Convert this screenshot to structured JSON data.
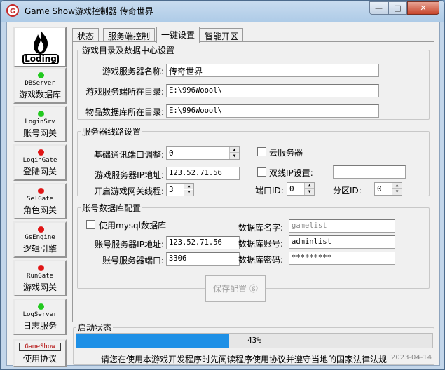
{
  "window": {
    "title": "Game Show游戏控制器  传奇世界"
  },
  "title_controls": {
    "minimize": "—",
    "maximize": "□",
    "close": "✕"
  },
  "nav": {
    "logo_label": "Loding",
    "items": [
      {
        "en": "DBServer",
        "cn": "游戏数据库",
        "status_color": "#22c91f"
      },
      {
        "en": "LoginSrv",
        "cn": "账号网关",
        "status_color": "#22c91f"
      },
      {
        "en": "LoginGate",
        "cn": "登陆网关",
        "status_color": "#e01515"
      },
      {
        "en": "SelGate",
        "cn": "角色网关",
        "status_color": "#e01515"
      },
      {
        "en": "GsEngine",
        "cn": "逻辑引擎",
        "status_color": "#e01515"
      },
      {
        "en": "RunGate",
        "cn": "游戏网关",
        "status_color": "#e01515"
      },
      {
        "en": "LogServer",
        "cn": "日志服务",
        "status_color": "#22c91f"
      }
    ],
    "about": {
      "en": "GameShow",
      "cn": "使用协议"
    }
  },
  "tabs": [
    "状态",
    "服务端控制",
    "一键设置",
    "智能开区"
  ],
  "active_tab": "一键设置",
  "game_dir": {
    "legend": "游戏目录及数据中心设置",
    "server_name_label": "游戏服务器名称:",
    "server_name_value": "传奇世界",
    "server_dir_label": "游戏服务端所在目录:",
    "server_dir_value": "E:\\996Woool\\",
    "item_db_label": "物品数据库所在目录:",
    "item_db_value": "E:\\996Woool\\"
  },
  "server_line": {
    "legend": "服务器线路设置",
    "base_port_label": "基础通讯端口调整:",
    "base_port_value": "0",
    "cloud_label": "云服务器",
    "ip_label": "游戏服务器IP地址:",
    "ip_value": "123.52.71.56",
    "dual_ip_label": "双线IP设置:",
    "dual_ip_value": "",
    "gate_threads_label": "开启游戏网关线程:",
    "gate_threads_value": "3",
    "port_id_label": "端口ID:",
    "port_id_value": "0",
    "zone_id_label": "分区ID:",
    "zone_id_value": "0"
  },
  "account_db": {
    "legend": "账号数据库配置",
    "use_mysql_label": "使用mysql数据库",
    "db_name_label": "数据库名字:",
    "db_name_value": "gamelist",
    "ip_label": "账号服务器IP地址:",
    "ip_value": "123.52.71.56",
    "db_account_label": "数据库账号:",
    "db_account_value": "adminlist",
    "port_label": "账号服务器端口:",
    "port_value": "3306",
    "db_password_label": "数据库密码:",
    "db_password_value": "*********"
  },
  "save_button": "保存配置 ⓖ",
  "status": {
    "legend": "启动状态",
    "progress_percent": 43,
    "progress_text": "43%",
    "notice": "请您在使用本游戏开发程序时先阅读程序使用协议并遵守当地的国家法律法规",
    "date": "2023-04-14"
  },
  "colors": {
    "progress": "#1e90e6",
    "status_on": "#22c91f",
    "status_off": "#e01515"
  }
}
